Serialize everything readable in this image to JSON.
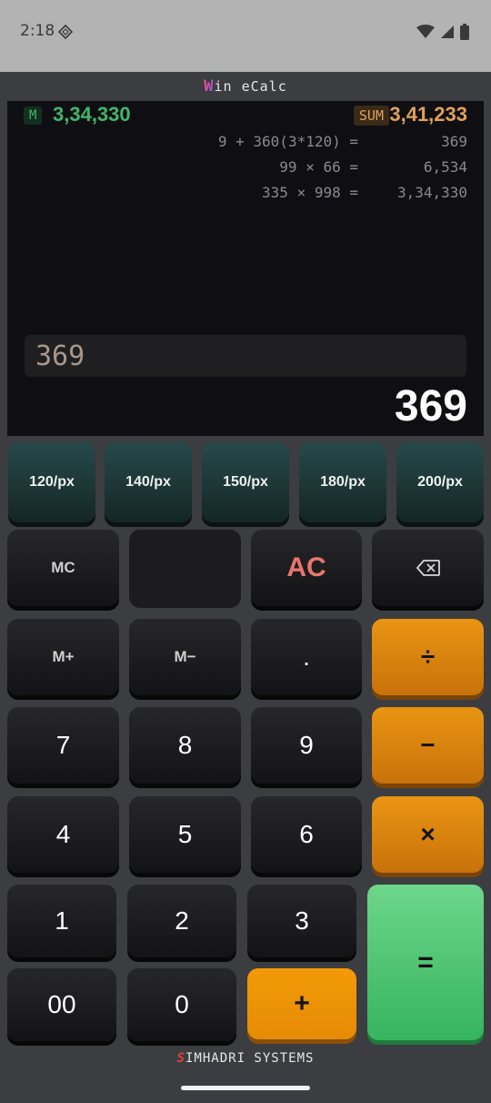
{
  "status_bar": {
    "time": "2:18",
    "icons": [
      "sim-card-icon",
      "wifi-icon",
      "signal-icon",
      "battery-icon"
    ]
  },
  "app": {
    "title_first": "W",
    "title_rest": "in eCalc"
  },
  "display": {
    "memory_label": "M",
    "memory_value": "3,34,330",
    "sum_label": "SUM",
    "sum_value": "3,41,233",
    "history": [
      {
        "expr": "9 + 360(3*120) =",
        "result": "369"
      },
      {
        "expr": "99 × 66 =",
        "result": "6,534"
      },
      {
        "expr": "335 × 998 =",
        "result": "3,34,330"
      }
    ],
    "input": "369",
    "result": "369"
  },
  "presets": [
    "120/px",
    "140/px",
    "150/px",
    "180/px",
    "200/px"
  ],
  "keys": {
    "mc": "MC",
    "ac": "AC",
    "backspace": "⌫",
    "m_plus": "M+",
    "m_minus": "M−",
    "dot": ".",
    "divide": "÷",
    "seven": "7",
    "eight": "8",
    "nine": "9",
    "minus": "−",
    "four": "4",
    "five": "5",
    "six": "6",
    "multiply": "×",
    "one": "1",
    "two": "2",
    "three": "3",
    "equals": "=",
    "double_zero": "00",
    "zero": "0",
    "plus": "+"
  },
  "footer": {
    "brand_first": "S",
    "brand_rest": "IMHADRI SYSTEMS"
  },
  "colors": {
    "memory": "#42b66b",
    "sum": "#e0a05a",
    "operator": "#e99512",
    "equals": "#36b45f",
    "ac": "#e8766d"
  }
}
